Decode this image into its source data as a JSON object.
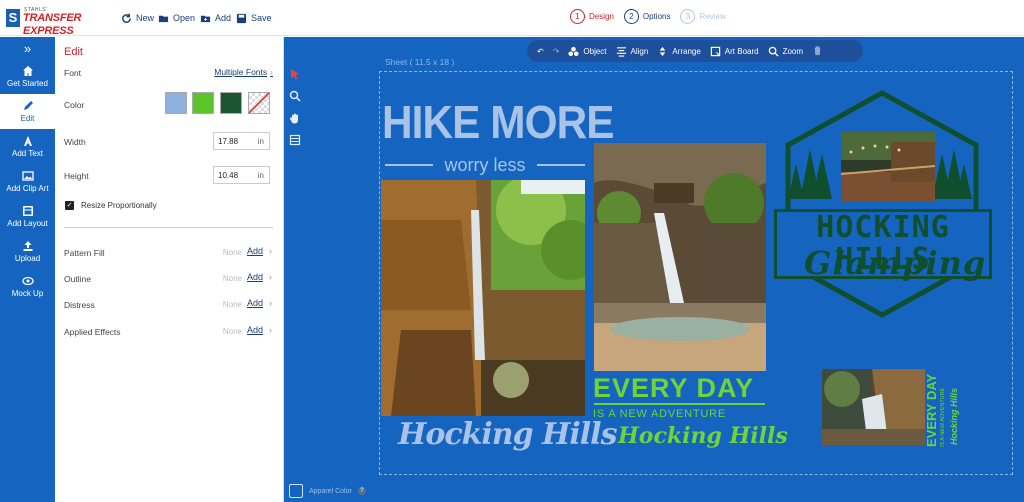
{
  "header": {
    "brand_small": "STAHLS'",
    "brand": "TRANSFER EXPRESS",
    "logo_mark": "S",
    "actions": [
      {
        "label": "New",
        "icon": "refresh-icon"
      },
      {
        "label": "Open",
        "icon": "folder-open-icon"
      },
      {
        "label": "Add",
        "icon": "folder-add-icon"
      },
      {
        "label": "Save",
        "icon": "save-icon"
      }
    ],
    "steps": [
      {
        "num": "1",
        "label": "Design",
        "state": "active"
      },
      {
        "num": "2",
        "label": "Options",
        "state": "next"
      },
      {
        "num": "3",
        "label": "Review",
        "state": "disabled"
      }
    ]
  },
  "nav": {
    "collapse": "»",
    "items": [
      {
        "label": "Get Started",
        "icon": "home-icon"
      },
      {
        "label": "Edit",
        "icon": "pencil-icon"
      },
      {
        "label": "Add Text",
        "icon": "text-icon"
      },
      {
        "label": "Add Clip Art",
        "icon": "image-icon"
      },
      {
        "label": "Add Layout",
        "icon": "layout-icon"
      },
      {
        "label": "Upload",
        "icon": "upload-icon"
      },
      {
        "label": "Mock Up",
        "icon": "eye-icon"
      }
    ]
  },
  "edit": {
    "title": "Edit",
    "font_label": "Font",
    "font_value": "Multiple Fonts",
    "color_label": "Color",
    "swatches": [
      "#8fb1de",
      "#5cc42a",
      "#1b5630",
      "none"
    ],
    "width_label": "Width",
    "width_value": "17.88",
    "height_label": "Height",
    "height_value": "10.48",
    "unit": "in",
    "resize_label": "Resize Proportionally",
    "resize_checked": true,
    "options": [
      {
        "label": "Pattern Fill",
        "none": "None",
        "add": "Add"
      },
      {
        "label": "Outline",
        "none": "None",
        "add": "Add"
      },
      {
        "label": "Distress",
        "none": "None",
        "add": "Add"
      },
      {
        "label": "Applied Effects",
        "none": "None",
        "add": "Add"
      }
    ]
  },
  "canvas_toolbar": {
    "items": [
      {
        "label": "Object",
        "icon": "shapes-icon"
      },
      {
        "label": "Align",
        "icon": "align-icon"
      },
      {
        "label": "Arrange",
        "icon": "arrange-icon"
      },
      {
        "label": "Art Board",
        "icon": "artboard-icon"
      },
      {
        "label": "Zoom",
        "icon": "zoom-icon"
      }
    ]
  },
  "sheet": {
    "label": "Sheet ( 11.5 x 18 )"
  },
  "artwork": {
    "hike_more": "HIKE MORE",
    "worry_less": "worry less",
    "hocking_hills_1": "Hocking Hills",
    "every_day": "EVERY DAY",
    "new_adventure": "IS A NEW ADVENTURE",
    "hocking_hills_2": "Hocking Hills",
    "logo_title": "HOCKING HILLS",
    "logo_sub": "Glamping",
    "vert_every_day": "EVERY DAY",
    "vert_adventure": "IS A NEW ADVENTURE",
    "vert_hocking": "Hocking Hills"
  },
  "footer": {
    "apparel_color": "Apparel Color",
    "help": "?"
  },
  "colors": {
    "brand_blue": "#1565c0",
    "accent_red": "#d32027",
    "light_blue_text": "#a9c3e8",
    "green_text": "#6fd435",
    "dark_green": "#0f4f2e"
  }
}
